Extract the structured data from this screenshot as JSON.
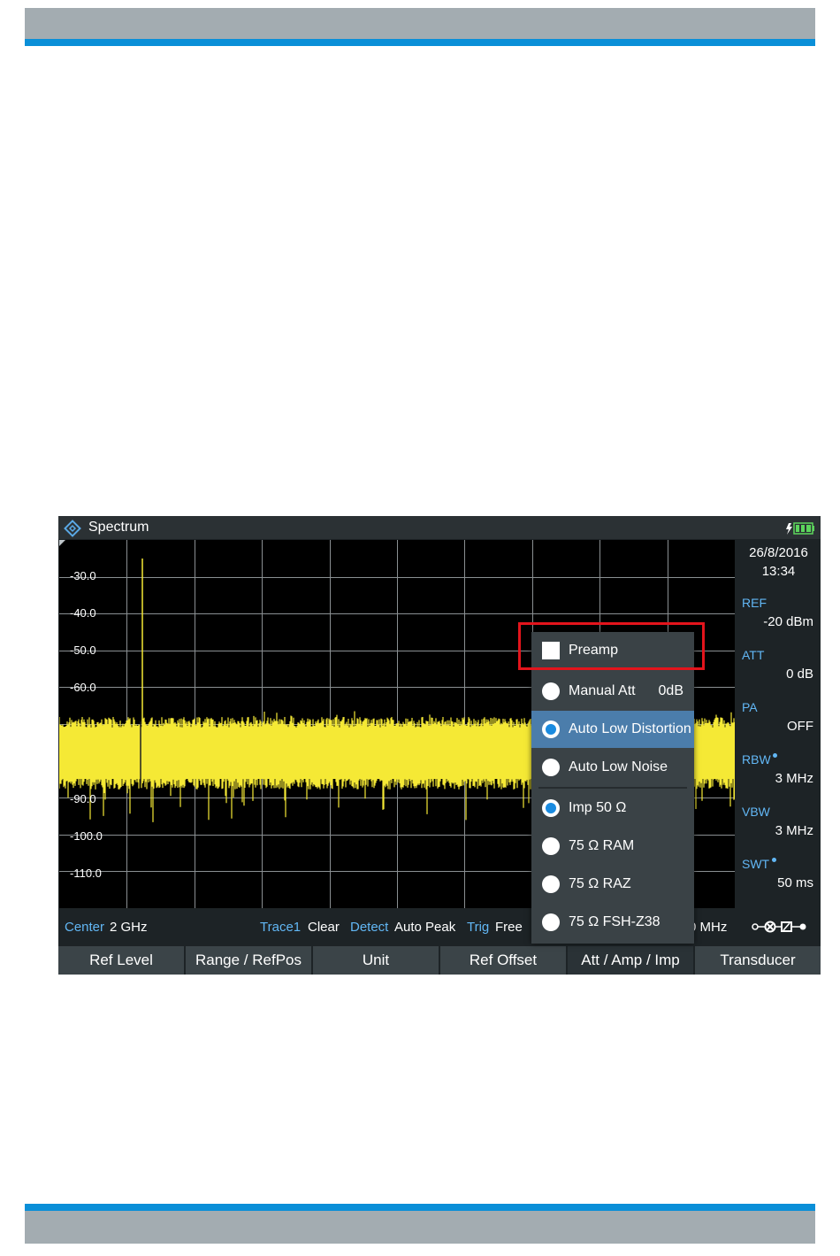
{
  "window": {
    "title": "Spectrum",
    "date": "26/8/2016",
    "time": "13:34"
  },
  "y_axis": {
    "ticks": [
      "-30.0",
      "-40.0",
      "-50.0",
      "-60.0",
      "-90.0",
      "-100.0",
      "-110.0"
    ]
  },
  "side_panel": {
    "ref_label": "REF",
    "ref_value": "-20 dBm",
    "att_label": "ATT",
    "att_value": "0 dB",
    "pa_label": "PA",
    "pa_value": "OFF",
    "rbw_label": "RBW",
    "rbw_value": "3 MHz",
    "vbw_label": "VBW",
    "vbw_value": "3 MHz",
    "swt_label": "SWT",
    "swt_value": "50 ms"
  },
  "status_bar": {
    "center_label": "Center",
    "center_value": "2 GHz",
    "trace_label": "Trace1",
    "trace_value": "Clear",
    "detect_label": "Detect",
    "detect_value": "Auto Peak",
    "trig_label": "Trig",
    "trig_value": "Free",
    "span_partial": "0 MHz"
  },
  "softkeys": [
    "Ref Level",
    "Range / RefPos",
    "Unit",
    "Ref Offset",
    "Att / Amp / Imp",
    "Transducer"
  ],
  "popup_menu": {
    "preamp": "Preamp",
    "preamp_checked": false,
    "manual_att": "Manual Att",
    "manual_att_value": "0dB",
    "auto_low_distortion": "Auto Low Distortion",
    "auto_low_noise": "Auto Low Noise",
    "imp_50": "Imp 50 Ω",
    "ram_75": "75 Ω RAM",
    "raz_75": "75 Ω RAZ",
    "fsh_75": "75 Ω FSH-Z38",
    "selected_attenuation": "Auto Low Distortion",
    "selected_impedance": "Imp 50 Ω"
  },
  "colors": {
    "trace": "#f5e935",
    "accent_label": "#62b7f5",
    "menu_selected": "#4b7dab",
    "highlight_box": "#e3141c",
    "doc_header_blue": "#0a8fd8",
    "doc_header_gray": "#a3acb1"
  },
  "icons": [
    "rohde-schwarz-logo-icon",
    "battery-charging-icon",
    "rf-connector-icon"
  ]
}
